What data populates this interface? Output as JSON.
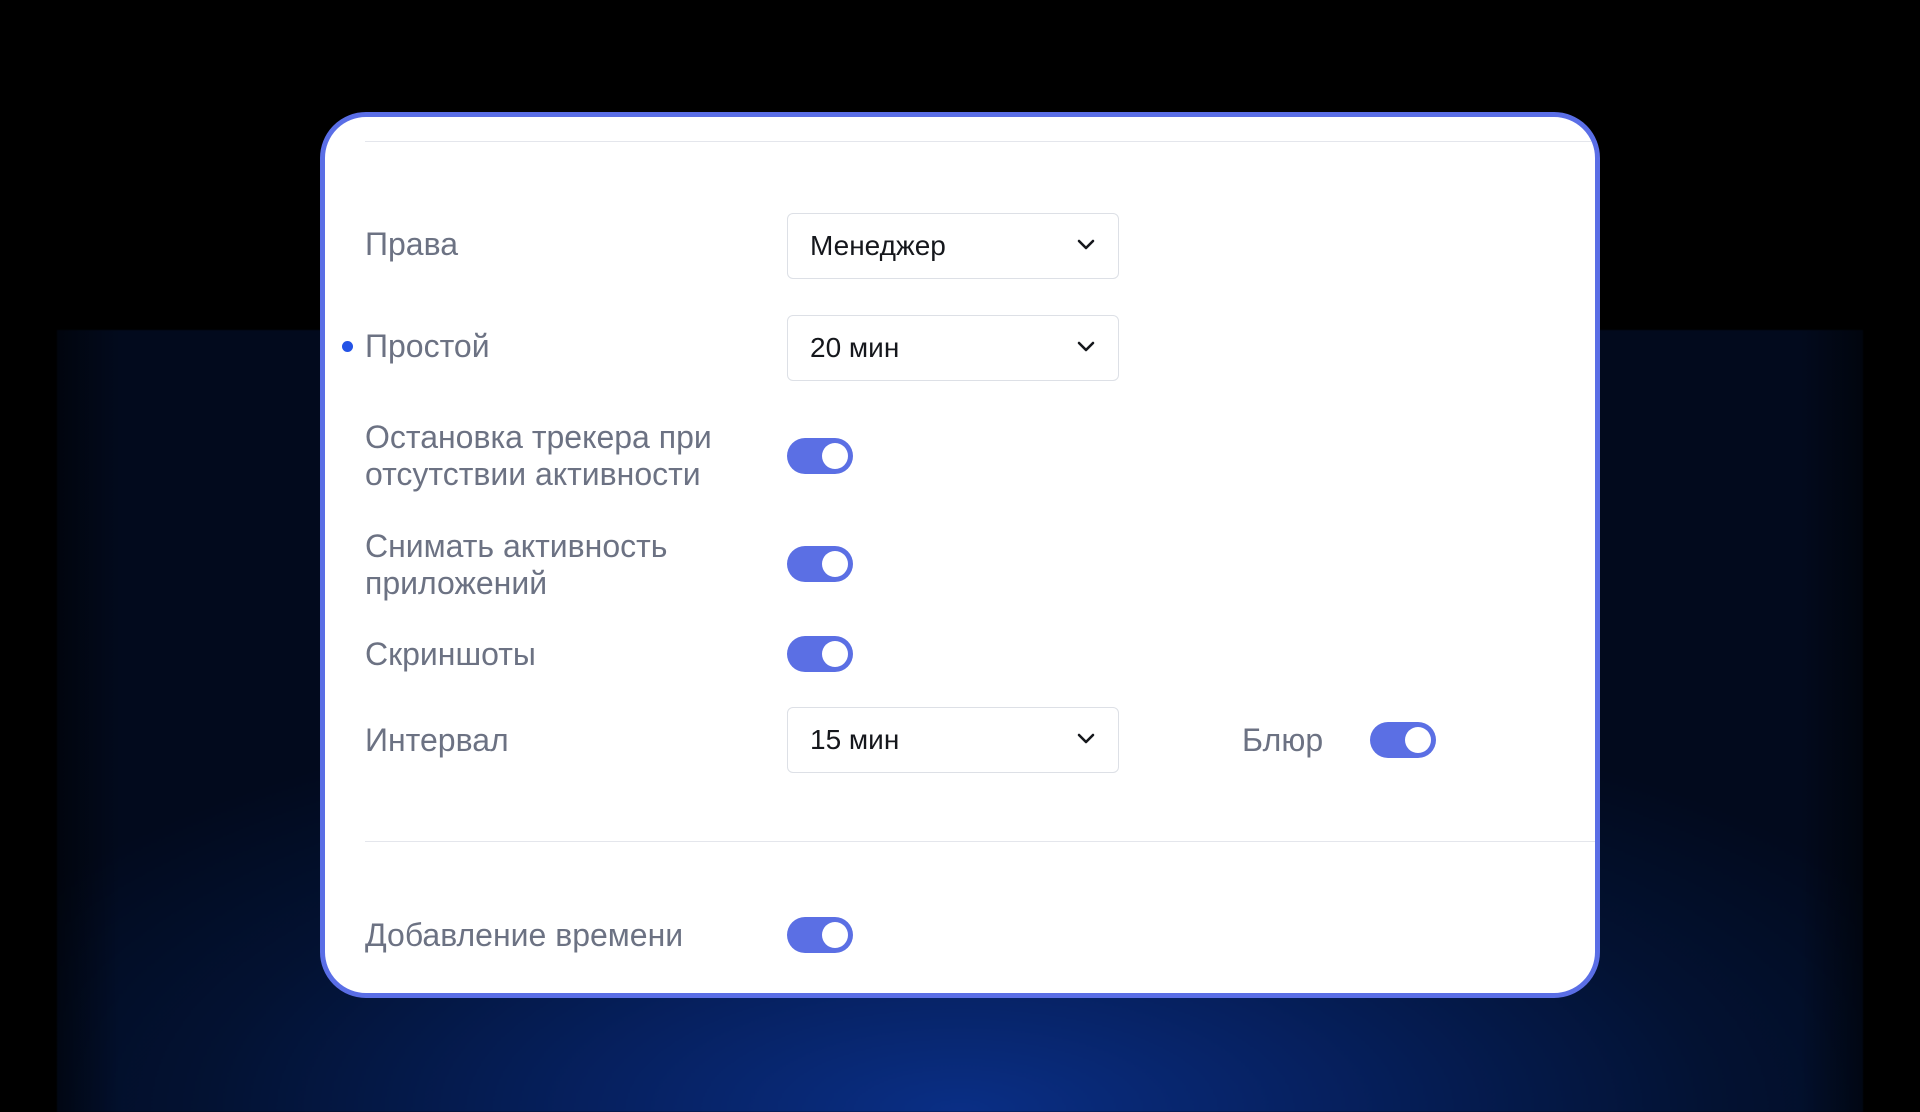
{
  "colors": {
    "card_border": "#5a6ee6",
    "toggle_on": "#5b6fe4",
    "label_text": "#6c7283",
    "value_text": "#15171c",
    "indicator_dot": "#2453e6"
  },
  "settings": {
    "permissions": {
      "label": "Права",
      "value": "Менеджер"
    },
    "idle": {
      "label": "Простой",
      "value": "20 мин",
      "has_indicator": true
    },
    "stop_tracker": {
      "label_line1": "Остановка трекера при",
      "label_line2": "отсутствии активности",
      "enabled": true
    },
    "app_activity": {
      "label_line1": "Снимать активность",
      "label_line2": "приложений",
      "enabled": true
    },
    "screenshots": {
      "label": "Скриншоты",
      "enabled": true
    },
    "interval": {
      "label": "Интервал",
      "value": "15 мин"
    },
    "blur": {
      "label": "Блюр",
      "enabled": true
    },
    "add_time": {
      "label": "Добавление времени",
      "enabled": true
    }
  }
}
